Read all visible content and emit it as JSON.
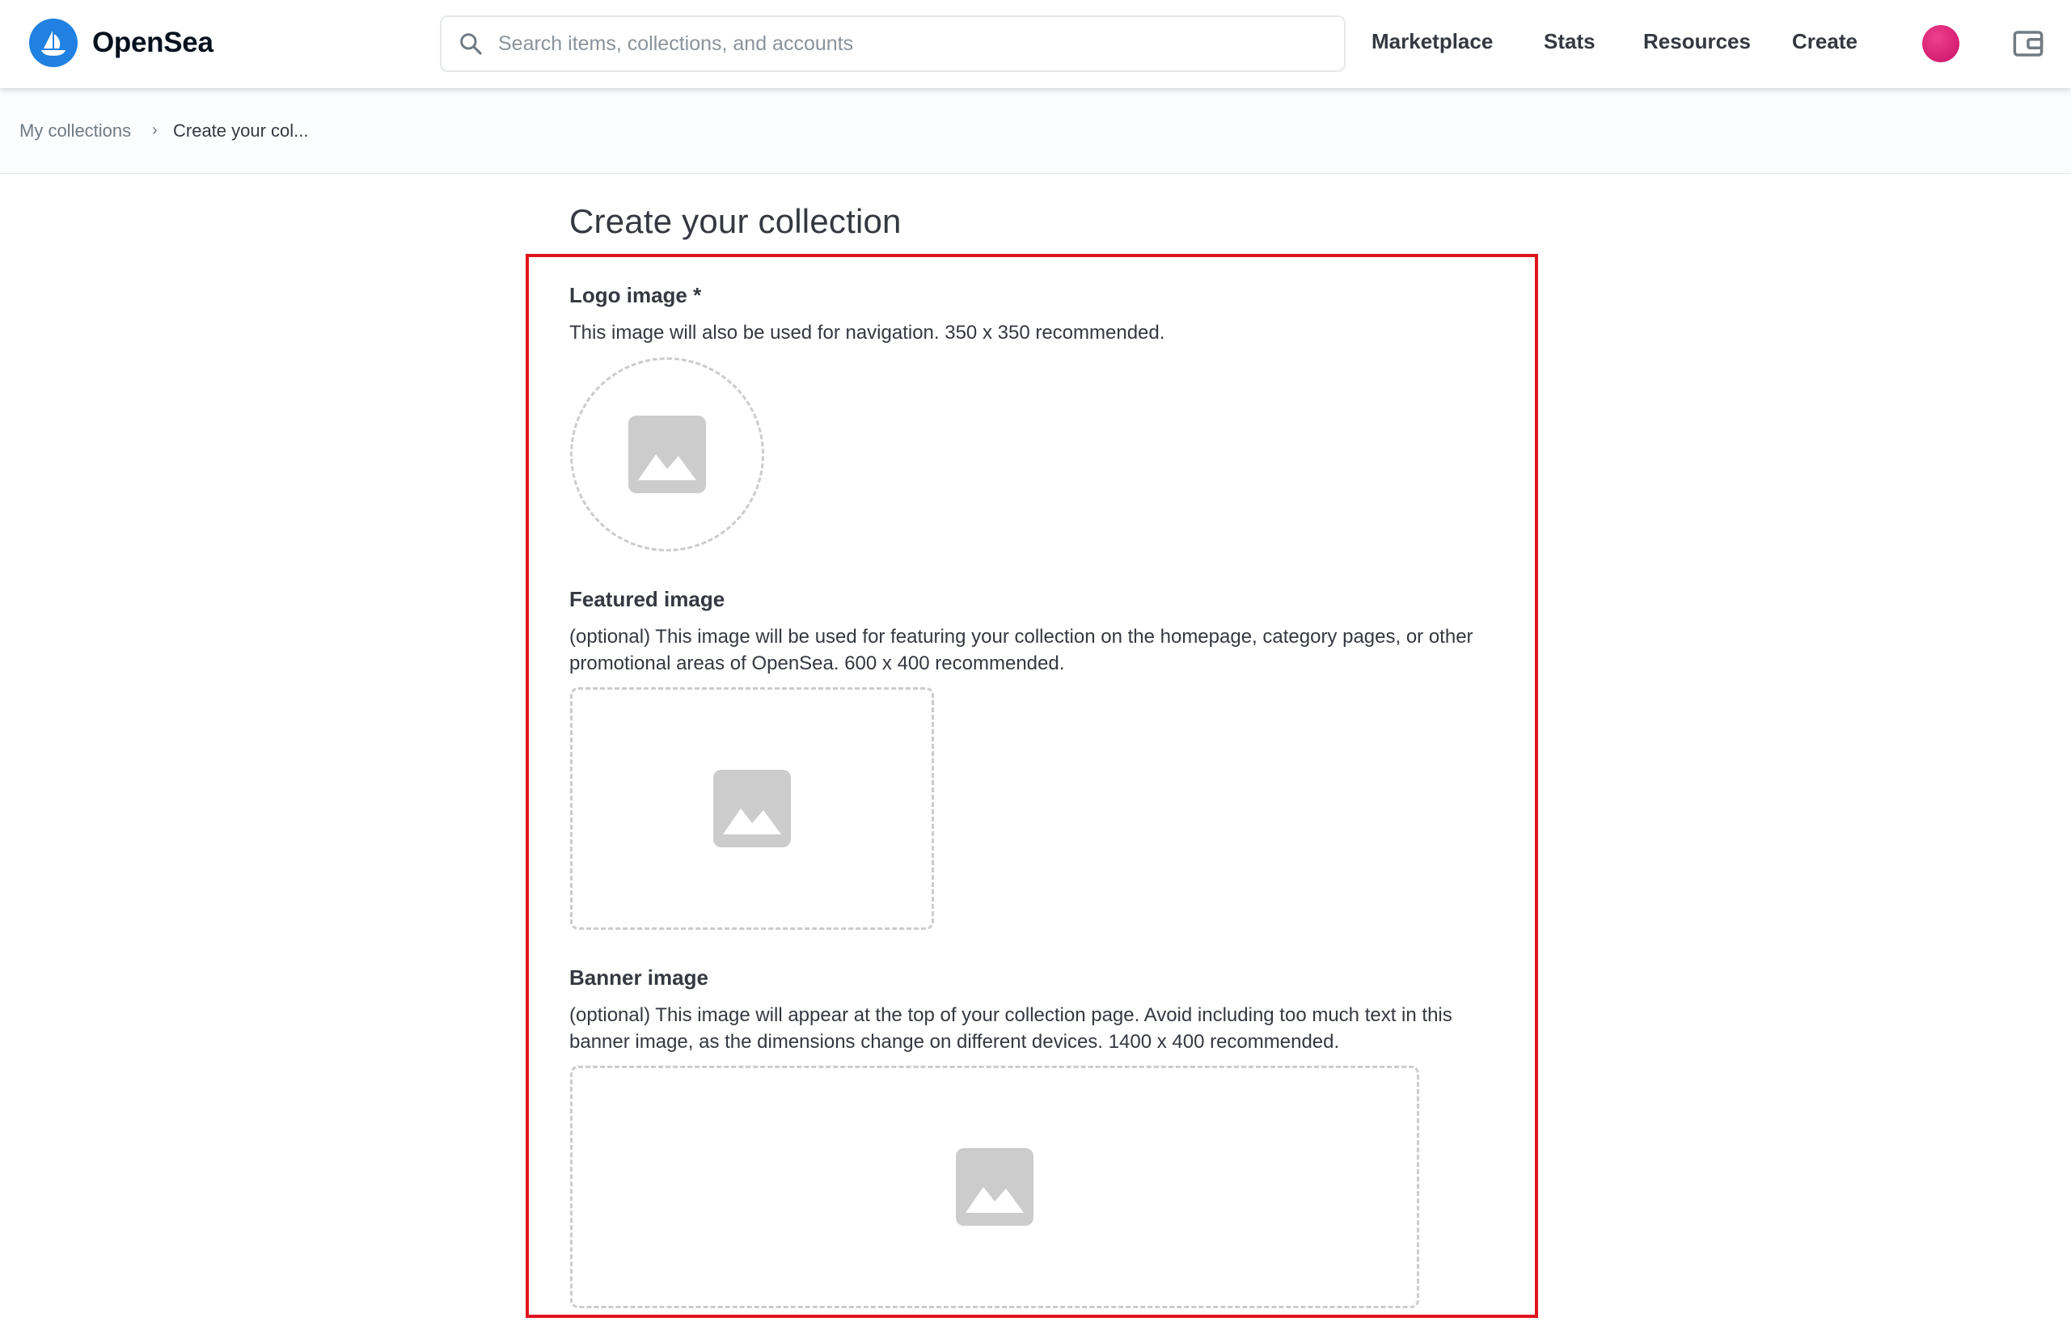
{
  "header": {
    "brand": "OpenSea",
    "search_placeholder": "Search items, collections, and accounts",
    "nav": [
      "Marketplace",
      "Stats",
      "Resources",
      "Create"
    ]
  },
  "breadcrumb": {
    "parent": "My collections",
    "separator": "›",
    "current": "Create your col..."
  },
  "page": {
    "title": "Create your collection"
  },
  "fields": {
    "logo": {
      "label": "Logo image *",
      "description": "This image will also be used for navigation. 350 x 350 recommended."
    },
    "featured": {
      "label": "Featured image",
      "description": "(optional) This image will be used for featuring your collection on the homepage, category pages, or other promotional areas of OpenSea. 600 x 400 recommended."
    },
    "banner": {
      "label": "Banner image",
      "description": "(optional) This image will appear at the top of your collection page. Avoid including too much text in this banner image, as the dimensions change on different devices. 1400 x 400 recommended."
    }
  },
  "icons": {
    "brand_logo": "opensea-logo-icon",
    "search": "search-icon",
    "wallet": "wallet-icon",
    "image_placeholder": "image-placeholder-icon"
  },
  "colors": {
    "brand_blue": "#2081e2",
    "avatar_pink": "#e0297e",
    "highlight_red": "#e0141e",
    "placeholder_gray": "#cccccc"
  }
}
